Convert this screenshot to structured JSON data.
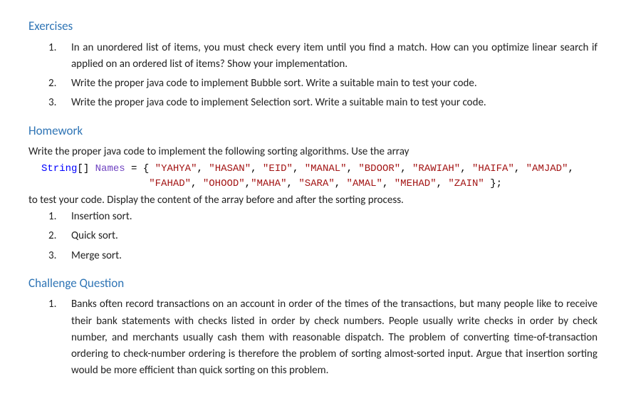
{
  "sections": {
    "exercises": {
      "heading": "Exercises",
      "items": [
        "In an unordered list of items, you must check every item until you find a match. How can you optimize linear search if applied on an ordered list of items? Show your implementation.",
        "Write the proper java code to implement Bubble sort. Write a suitable main to test your code.",
        "Write the proper java code to implement Selection sort. Write a suitable main to test your code."
      ]
    },
    "homework": {
      "heading": "Homework",
      "intro": "Write the proper java code to implement the following sorting algorithms. Use the array",
      "code": {
        "type": "String",
        "brackets": "[]",
        "varname": "Names",
        "equals": " = { ",
        "values": [
          "\"YAHYA\"",
          "\"HASAN\"",
          "\"EID\"",
          "\"MANAL\"",
          "\"BDOOR\"",
          "\"RAWIAH\"",
          "\"HAIFA\"",
          "\"AMJAD\"",
          "\"FAHAD\"",
          "\"OHOOD\"",
          "\"MAHA\"",
          "\"SARA\"",
          "\"AMAL\"",
          "\"MEHAD\"",
          "\"ZAIN\""
        ],
        "close": " };"
      },
      "outro": "to test your code. Display the content of the array before and after the sorting process.",
      "items": [
        "Insertion sort.",
        "Quick sort.",
        "Merge sort."
      ]
    },
    "challenge": {
      "heading": "Challenge Question",
      "items": [
        "Banks often record transactions on an account in order of the times of the transactions, but many people like to receive their bank statements with checks listed in order by check numbers. People usually write checks in order by check number, and merchants usually cash them with reasonable dispatch. The problem of converting time-of-transaction ordering to check-number ordering is therefore the problem of sorting almost-sorted input. Argue that insertion sorting would be more efficient than quick sorting on this problem."
      ]
    }
  }
}
